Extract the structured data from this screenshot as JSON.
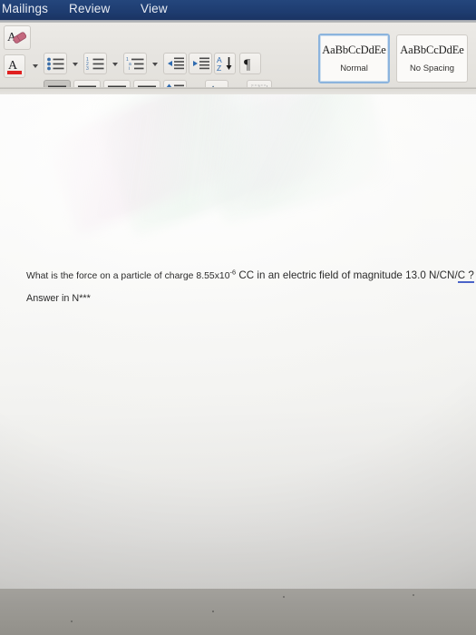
{
  "window": {
    "app": "word-document-photo"
  },
  "ribbon": {
    "tabs": [
      {
        "label": "Mailings",
        "active": false
      },
      {
        "label": "Review",
        "active": false
      },
      {
        "label": "View",
        "active": false
      }
    ],
    "active_tab": "Home",
    "buttons": [
      {
        "name": "clear-formatting",
        "icon": "clear-formatting-icon"
      },
      {
        "name": "text-highlight-color",
        "icon": "highlight-color-icon"
      },
      {
        "name": "bullets",
        "icon": "bullet-list-icon"
      },
      {
        "name": "numbering",
        "icon": "numbered-list-icon"
      },
      {
        "name": "multilevel-list",
        "icon": "multilevel-list-icon"
      },
      {
        "name": "decrease-indent",
        "icon": "decrease-indent-icon"
      },
      {
        "name": "increase-indent",
        "icon": "increase-indent-icon"
      },
      {
        "name": "sort",
        "icon": "sort-az-icon"
      },
      {
        "name": "show-formatting-marks",
        "icon": "pilcrow-icon"
      },
      {
        "name": "align-left",
        "icon": "align-left-icon"
      },
      {
        "name": "align-center",
        "icon": "align-center-icon"
      },
      {
        "name": "align-right",
        "icon": "align-right-icon"
      },
      {
        "name": "justify",
        "icon": "justify-icon"
      },
      {
        "name": "line-spacing",
        "icon": "line-spacing-icon"
      },
      {
        "name": "shading",
        "icon": "paint-bucket-icon"
      },
      {
        "name": "borders",
        "icon": "borders-grid-icon"
      }
    ],
    "styles": [
      {
        "sample": "AaBbCcDdEe",
        "name": "Normal",
        "selected": true
      },
      {
        "sample": "AaBbCcDdEe",
        "name": "No Spacing",
        "selected": false
      }
    ]
  },
  "document": {
    "question": {
      "part1": "What is the force on a particle of charge 8.55x10",
      "exponent": "-6",
      "part2": " CC in an electric field of magnitude 13.0 N/CN/",
      "marked": "C ?"
    },
    "answer_prompt": "Answer in N***"
  },
  "colors": {
    "ribbon_tabbar": "#1e3c70",
    "ribbon_body": "#e7e5e1",
    "style_selected_border": "#8cb4dd",
    "spellcheck_underline": "#4a63c8",
    "document_text": "#2b2b2b",
    "desk": "#9a9893"
  }
}
